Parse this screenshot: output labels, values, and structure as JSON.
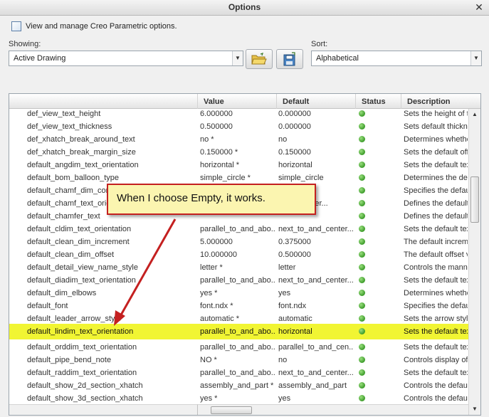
{
  "window": {
    "title": "Options"
  },
  "description": "View and manage Creo Parametric options.",
  "showing": {
    "label": "Showing:",
    "value": "Active Drawing"
  },
  "sort": {
    "label": "Sort:",
    "value": "Alphabetical"
  },
  "columns": {
    "option": "",
    "value": "Value",
    "default": "Default",
    "status": "Status",
    "description": "Description"
  },
  "rows": [
    {
      "option": "def_view_text_height",
      "value": "6.000000",
      "default": "0.000000",
      "description": "Sets the height of t"
    },
    {
      "option": "def_view_text_thickness",
      "value": "0.500000",
      "default": "0.000000",
      "description": "Sets default thickne"
    },
    {
      "option": "def_xhatch_break_around_text",
      "value": "no *",
      "default": "no",
      "description": "Determines whethe"
    },
    {
      "option": "def_xhatch_break_margin_size",
      "value": "0.150000 *",
      "default": "0.150000",
      "description": "Sets the default off"
    },
    {
      "option": "default_angdim_text_orientation",
      "value": "horizontal *",
      "default": "horizontal",
      "description": "Sets the default tex"
    },
    {
      "option": "default_bom_balloon_type",
      "value": "simple_circle *",
      "default": "simple_circle",
      "description": "Determines the defa"
    },
    {
      "option": "default_chamf_dim_con",
      "value": "",
      "default": "",
      "description": "Specifies the defau"
    },
    {
      "option": "default_chamf_text_orie",
      "value": "",
      "default": "_and_center...",
      "description": "Defines the default"
    },
    {
      "option": "default_chamfer_text",
      "value": "",
      "default": "",
      "description": "Defines the default"
    },
    {
      "option": "default_cldim_text_orientation",
      "value": "parallel_to_and_abo...",
      "default": "next_to_and_center...",
      "description": "Sets the default tex"
    },
    {
      "option": "default_clean_dim_increment",
      "value": "5.000000",
      "default": "0.375000",
      "description": "The default increme"
    },
    {
      "option": "default_clean_dim_offset",
      "value": "10.000000",
      "default": "0.500000",
      "description": "The default offset v"
    },
    {
      "option": "default_detail_view_name_style",
      "value": "letter *",
      "default": "letter",
      "description": "Controls the manne"
    },
    {
      "option": "default_diadim_text_orientation",
      "value": "parallel_to_and_abo...",
      "default": "next_to_and_center...",
      "description": "Sets the default tex"
    },
    {
      "option": "default_dim_elbows",
      "value": "yes *",
      "default": "yes",
      "description": "Determines whethe"
    },
    {
      "option": "default_font",
      "value": "font.ndx *",
      "default": "font.ndx",
      "description": "Specifies the defau"
    },
    {
      "option": "default_leader_arrow_style",
      "value": "automatic *",
      "default": "automatic",
      "description": "Sets the arrow styl"
    },
    {
      "option": "default_lindim_text_orientation",
      "value": "parallel_to_and_abo...",
      "default": "horizontal",
      "description": "Sets the default tex"
    },
    {
      "option": "default_orddim_text_orientation",
      "value": "parallel_to_and_abo...",
      "default": "parallel_to_and_cen...",
      "description": "Sets the default tex"
    },
    {
      "option": "default_pipe_bend_note",
      "value": "NO *",
      "default": "no",
      "description": "Controls display of"
    },
    {
      "option": "default_raddim_text_orientation",
      "value": "parallel_to_and_abo...",
      "default": "next_to_and_center...",
      "description": "Sets the default tex"
    },
    {
      "option": "default_show_2d_section_xhatch",
      "value": "assembly_and_part *",
      "default": "assembly_and_part",
      "description": "Controls the defaul"
    },
    {
      "option": "default_show_3d_section_xhatch",
      "value": "yes *",
      "default": "yes",
      "description": "Controls the defaul"
    }
  ],
  "highlighted_row": 17,
  "callout": {
    "text": "When I choose Empty, it works."
  },
  "colors": {
    "highlight": "#f1f533",
    "status_ok": "#3c9b2a",
    "callout_border": "#c42020",
    "callout_fill": "#fbf5b0",
    "arrow": "#c42020"
  }
}
